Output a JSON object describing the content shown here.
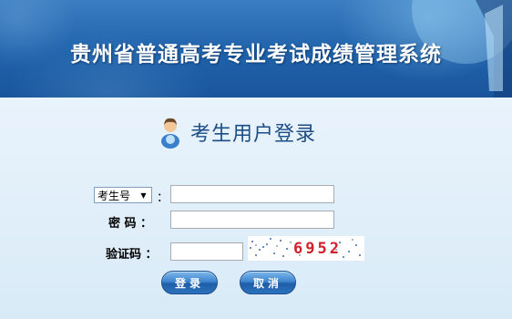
{
  "header": {
    "title": "贵州省普通高考专业考试成绩管理系统"
  },
  "login": {
    "heading": "考生用户登录",
    "heading_icon": "user-icon",
    "id_type_selected": "考生号",
    "colon": "：",
    "password_label": "密 码 ：",
    "captcha_label": "验证码 ：",
    "id_value": "",
    "password_value": "",
    "captcha_value": "",
    "captcha_code": "6952",
    "login_button": "登录",
    "cancel_button": "取消"
  },
  "colors": {
    "header_blue": "#1f62aa",
    "panel_bg": "#e4f0fa",
    "heading_text": "#1c4d86",
    "captcha_text": "#d0202a",
    "button_blue": "#2c72bd"
  }
}
